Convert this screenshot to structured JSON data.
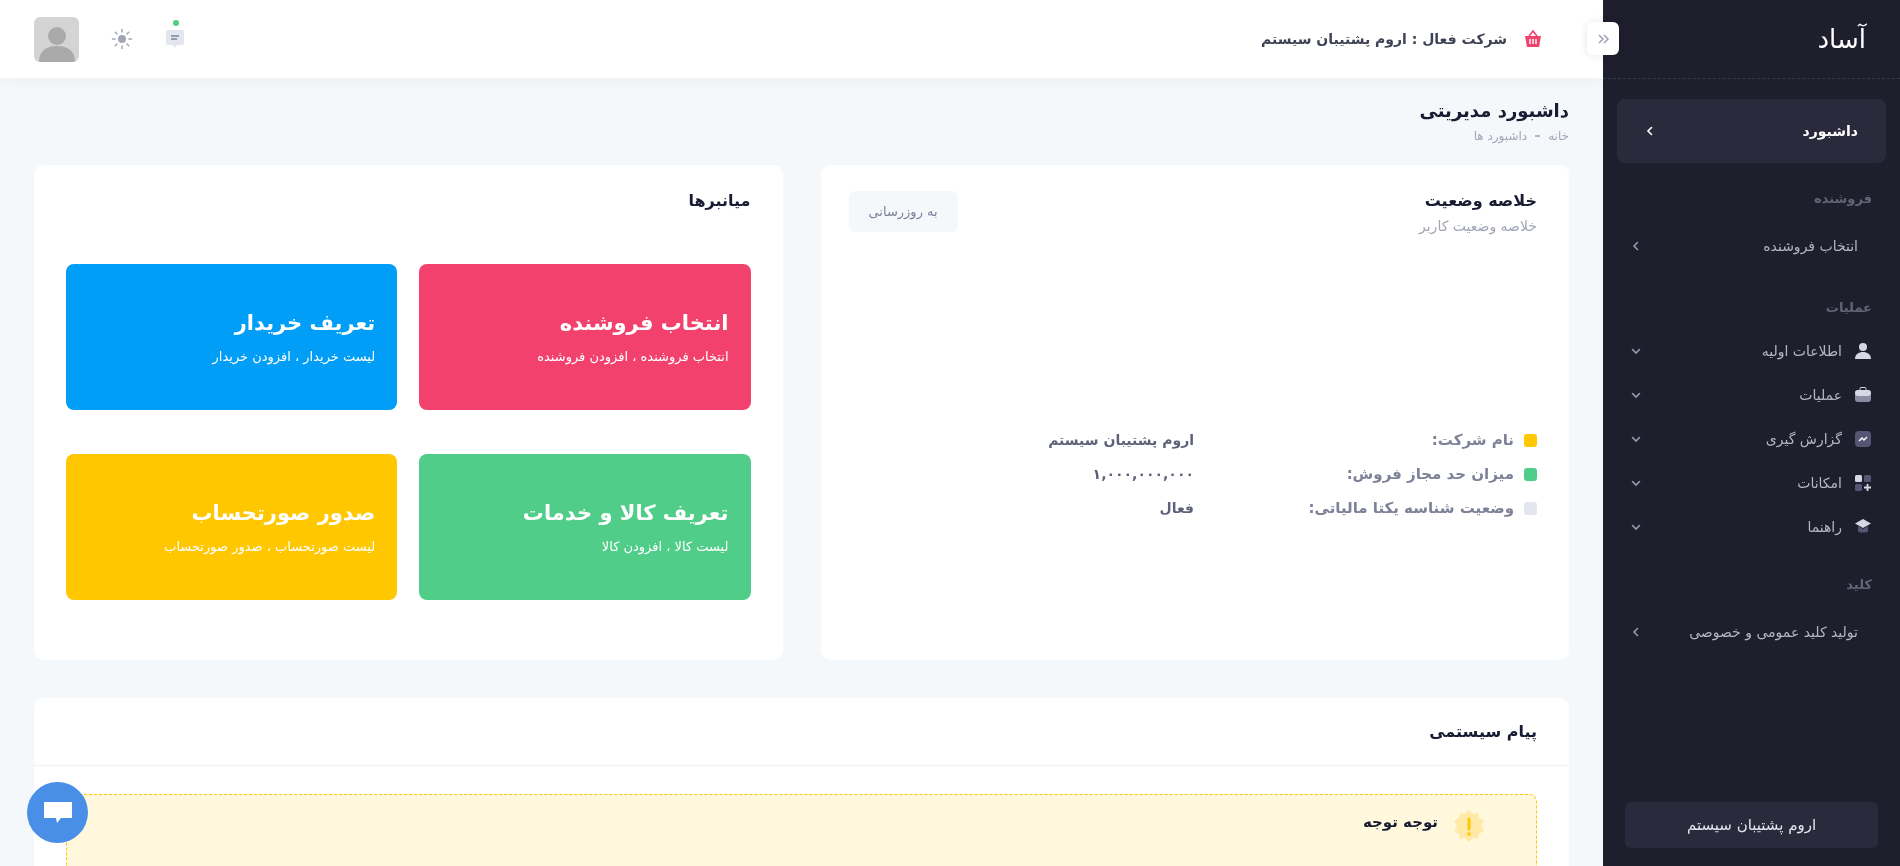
{
  "sidebar": {
    "logo": "آساد",
    "items": [
      {
        "kind": "link",
        "label": "داشبورد",
        "selected": true
      },
      {
        "kind": "heading",
        "label": "فروشنده"
      },
      {
        "kind": "link",
        "label": "انتخاب فروشنده",
        "selected": false
      },
      {
        "kind": "heading",
        "label": "عملیات"
      },
      {
        "kind": "menu",
        "label": "اطلاعات اولیه",
        "expanded": false
      },
      {
        "kind": "menu",
        "label": "عملیات",
        "expanded": false
      },
      {
        "kind": "menu",
        "label": "گزارش گیری",
        "expanded": false
      },
      {
        "kind": "menu",
        "label": "امکانات",
        "expanded": false
      },
      {
        "kind": "menu",
        "label": "راهنما",
        "expanded": false
      },
      {
        "kind": "heading",
        "label": "کلید"
      },
      {
        "kind": "link",
        "label": "تولید کلید عمومی و خصوصی",
        "selected": false
      }
    ],
    "footer": "اروم پشتیبان سیستم"
  },
  "header": {
    "company": "شرکت فعال : اروم پشتیبان سیستم",
    "unread": true
  },
  "page": {
    "title": "داشبورد مدیریتی",
    "breadcrumb": [
      "خانه",
      "داشبورد ها"
    ]
  },
  "summary": {
    "title": "خلاصه وضعیت",
    "subtitle": "خلاصه وضعیت کاربر",
    "button": "به روزرسانی",
    "rows": [
      {
        "label": "نام شرکت:",
        "value": "اروم پشتیبان سیستم",
        "color": "#ffc700"
      },
      {
        "label": "میزان حد مجاز فروش:",
        "value": "۱,۰۰۰,۰۰۰,۰۰۰",
        "color": "#50cd89"
      },
      {
        "label": "وضعیت شناسه یکتا مالیاتی:",
        "value": "فعال",
        "color": "#e4e6ef"
      }
    ]
  },
  "shortcuts": {
    "title": "میانبرها",
    "tiles": [
      {
        "title": "انتخاب فروشنده",
        "subtitle": "انتخاب فروشنده ، افزودن فروشنده",
        "color": "#f1416c"
      },
      {
        "title": "تعریف خریدار",
        "subtitle": "لیست خریدار ، افزودن خریدار",
        "color": "#009ef7"
      },
      {
        "title": "تعریف کالا و خدمات",
        "subtitle": "لیست کالا ، افزودن کالا",
        "color": "#50cd89"
      },
      {
        "title": "صدور صورتحساب",
        "subtitle": "لیست صورتحساب ، صدور صورتحساب",
        "color": "#ffc700"
      }
    ]
  },
  "system_message": {
    "title": "پیام سیستمی",
    "alert_title": "توجه توجه"
  }
}
